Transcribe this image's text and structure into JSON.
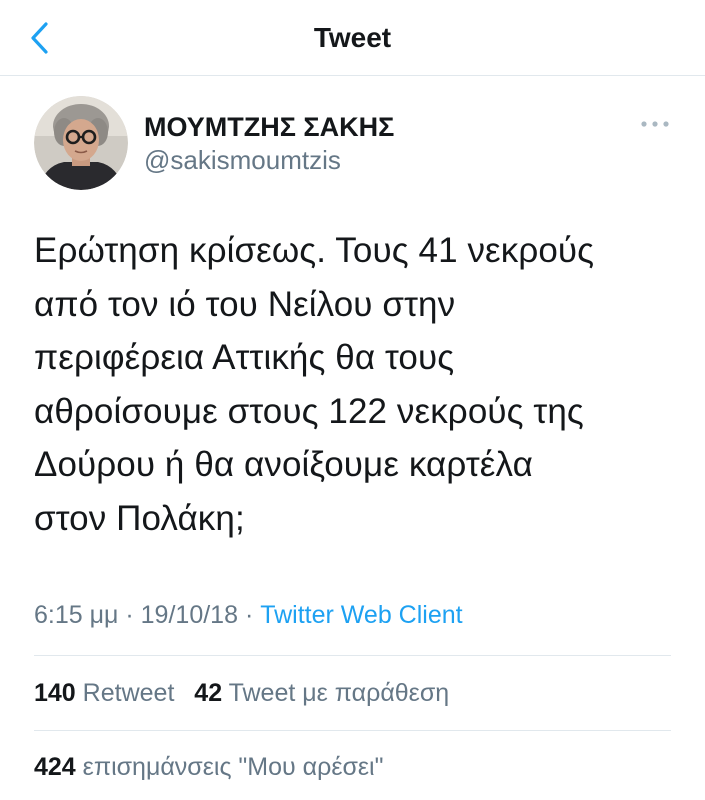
{
  "header": {
    "title": "Tweet",
    "back_icon": "chevron-left-icon",
    "accent_color": "#1da1f2"
  },
  "author": {
    "display_name": "ΜΟΥΜΤΖΗΣ ΣΑΚΗΣ",
    "handle": "@sakismoumtzis",
    "more_icon": "more-horizontal-icon"
  },
  "tweet": {
    "lines": [
      "Ερώτηση κρίσεως. Τους 41 νεκρούς",
      "από τον ιό του Νείλου στην",
      "περιφέρεια Αττικής θα τους",
      "αθροίσουμε στους 122 νεκρούς της",
      "Δούρου ή θα ανοίξουμε καρτέλα",
      "στον Πολάκη;"
    ],
    "time": "6:15 μμ",
    "separator": "·",
    "date": "19/10/18",
    "source": "Twitter Web Client"
  },
  "stats": {
    "retweets_count": "140",
    "retweets_label": "Retweet",
    "quotes_count": "42",
    "quotes_label": "Tweet με παράθεση",
    "likes_count": "424",
    "likes_label": "επισημάνσεις \"Μου αρέσει\""
  }
}
